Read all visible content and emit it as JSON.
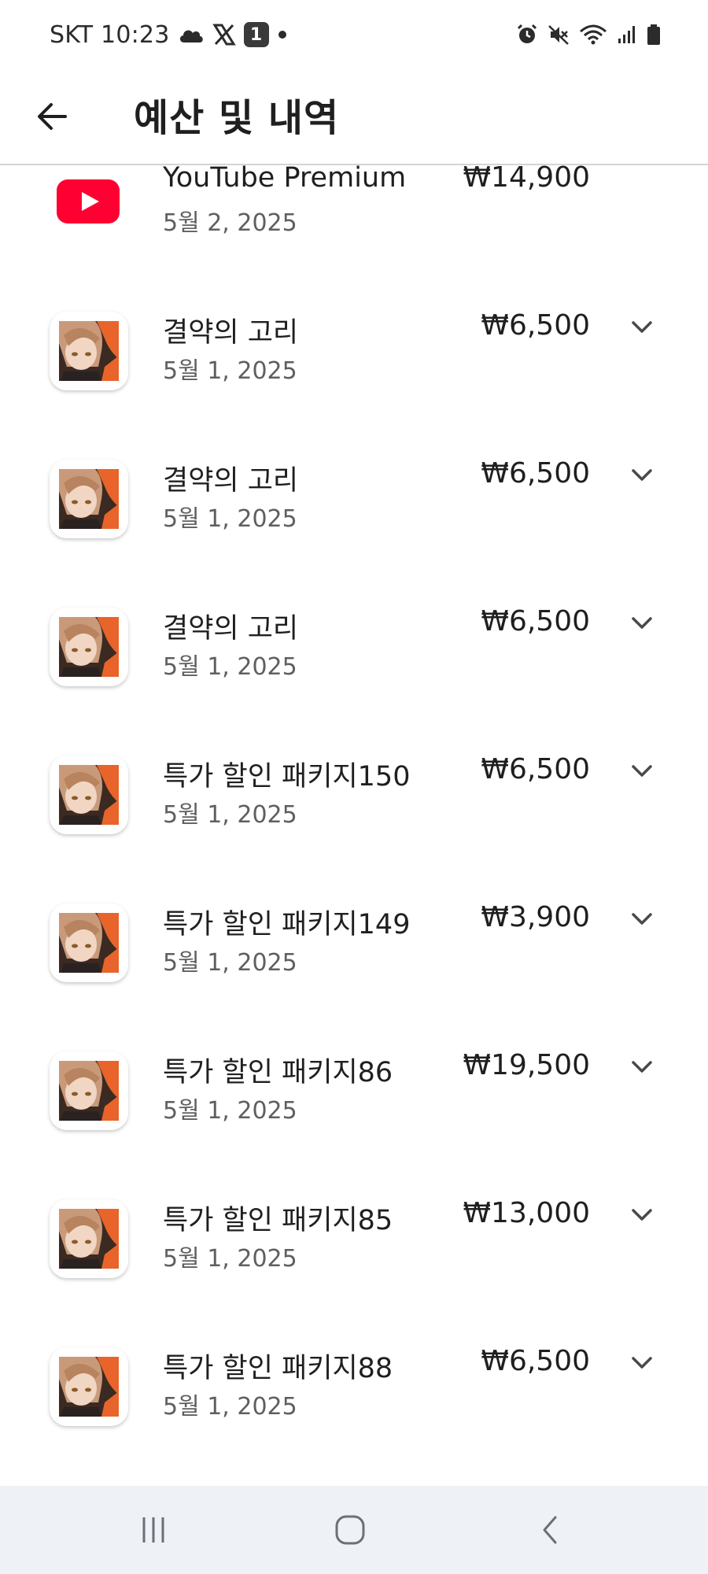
{
  "status_bar": {
    "carrier_time": "SKT 10:23",
    "notification_badge": "1",
    "icons": [
      "cloud-icon",
      "x-app-icon",
      "notification-badge-icon",
      "dot-icon",
      "alarm-icon",
      "mute-icon",
      "wifi-icon",
      "signal-icon",
      "battery-icon"
    ]
  },
  "app_bar": {
    "title": "예산 및 내역",
    "back_icon": "arrow-left-icon"
  },
  "transactions": [
    {
      "title": "YouTube Premium",
      "date": "5월 2, 2025",
      "price": "₩14,900",
      "icon": "youtube-icon",
      "expandable": false
    },
    {
      "title": "결약의 고리",
      "date": "5월 1, 2025",
      "price": "₩6,500",
      "icon": "game-app-icon",
      "expandable": true
    },
    {
      "title": "결약의 고리",
      "date": "5월 1, 2025",
      "price": "₩6,500",
      "icon": "game-app-icon",
      "expandable": true
    },
    {
      "title": "결약의 고리",
      "date": "5월 1, 2025",
      "price": "₩6,500",
      "icon": "game-app-icon",
      "expandable": true
    },
    {
      "title": "특가 할인 패키지150",
      "date": "5월 1, 2025",
      "price": "₩6,500",
      "icon": "game-app-icon",
      "expandable": true
    },
    {
      "title": "특가 할인 패키지149",
      "date": "5월 1, 2025",
      "price": "₩3,900",
      "icon": "game-app-icon",
      "expandable": true
    },
    {
      "title": "특가 할인 패키지86",
      "date": "5월 1, 2025",
      "price": "₩19,500",
      "icon": "game-app-icon",
      "expandable": true
    },
    {
      "title": "특가 할인 패키지85",
      "date": "5월 1, 2025",
      "price": "₩13,000",
      "icon": "game-app-icon",
      "expandable": true
    },
    {
      "title": "특가 할인 패키지88",
      "date": "5월 1, 2025",
      "price": "₩6,500",
      "icon": "game-app-icon",
      "expandable": true
    }
  ],
  "nav_bar": {
    "buttons": [
      "recent-apps-icon",
      "home-icon",
      "back-icon"
    ]
  },
  "colors": {
    "youtube_red": "#ff0033",
    "nav_bg": "#eef1f6",
    "divider": "#d4d4d4",
    "text_primary": "#1f1f1f",
    "text_secondary": "#5f5f5f"
  }
}
